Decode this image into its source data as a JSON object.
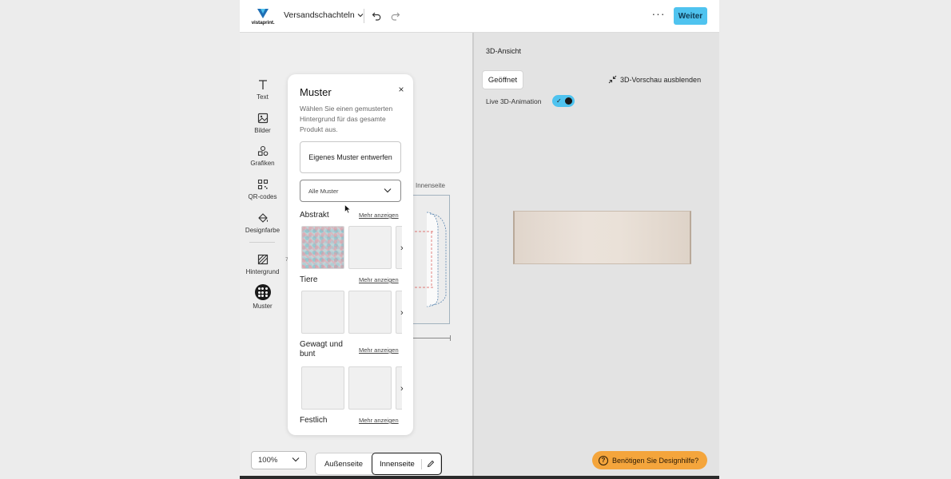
{
  "header": {
    "logo_text": "vistaprint.",
    "project_name": "Versandschachteln",
    "more_label": "···",
    "next_label": "Weiter"
  },
  "tools": [
    {
      "label": "Text",
      "icon": "text-icon"
    },
    {
      "label": "Bilder",
      "icon": "image-icon"
    },
    {
      "label": "Grafiken",
      "icon": "shapes-icon"
    },
    {
      "label": "QR-codes",
      "icon": "qr-code-icon"
    },
    {
      "label": "Designfarbe",
      "icon": "paint-bucket-icon"
    },
    {
      "label": "Hintergrund",
      "icon": "background-icon"
    },
    {
      "label": "Muster",
      "icon": "pattern-icon"
    }
  ],
  "panel": {
    "title": "Muster",
    "close_label": "×",
    "description": "Wählen Sie einen gemusterten Hintergrund für das gesamte Produkt aus.",
    "own_pattern_button": "Eigenes Muster entwerfen",
    "filter_value": "Alle Muster",
    "sections": [
      {
        "title": "Abstrakt",
        "more": "Mehr anzeigen"
      },
      {
        "title": "Tiere",
        "more": "Mehr anzeigen"
      },
      {
        "title": "Gewagt und bunt",
        "more": "Mehr anzeigen"
      },
      {
        "title": "Festlich",
        "more": "Mehr anzeigen"
      }
    ]
  },
  "canvas": {
    "side_label": "Innenseite",
    "fold_marker": "7"
  },
  "bottom": {
    "zoom": "100%",
    "tab_outside": "Außenseite",
    "tab_inside": "Innenseite"
  },
  "view3d": {
    "title": "3D-Ansicht",
    "opened_button": "Geöffnet",
    "hide_label": "3D-Vorschau ausblenden",
    "live_label": "Live 3D-Animation",
    "live_on": true,
    "help_label": "Benötigen Sie Designhilfe?",
    "help_icon_glyph": "?"
  },
  "colors": {
    "accent": "#4fc3ef",
    "help": "#f4a53c",
    "logo_blue": "#1f6fb5",
    "logo_cyan": "#4fc3ef"
  }
}
